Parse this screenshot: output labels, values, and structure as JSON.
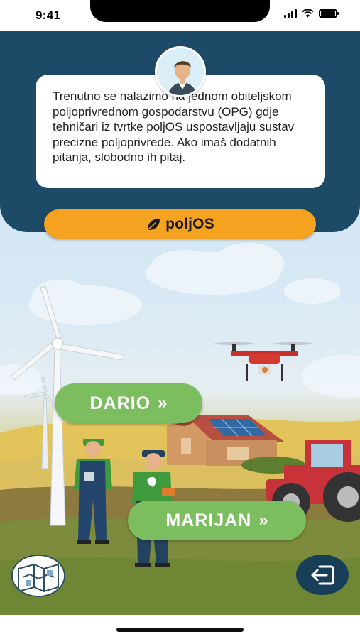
{
  "status_bar": {
    "time": "9:41"
  },
  "guide": {
    "avatar_icon": "person-avatar-icon",
    "message": "Trenutno se nalazimo na jednom obiteljskom poljoprivrednom gospodarstvu (OPG) gdje tehničari iz tvrtke poljOS uspostavljaju sustav precizne poljoprivrede. Ako imaš dodatnih pitanja, slobodno ih pitaj."
  },
  "brand": {
    "label": "poljOS",
    "icon": "leaf-icon",
    "color": "#f4a21f"
  },
  "characters": [
    {
      "label": "DARIO",
      "chevron": "»"
    },
    {
      "label": "MARIJAN",
      "chevron": "»"
    }
  ],
  "controls": {
    "map_icon": "map-icon",
    "exit_icon": "exit-icon"
  },
  "colors": {
    "header": "#1d4a66",
    "accent_green": "#7cbd5f",
    "exit": "#173f58"
  }
}
